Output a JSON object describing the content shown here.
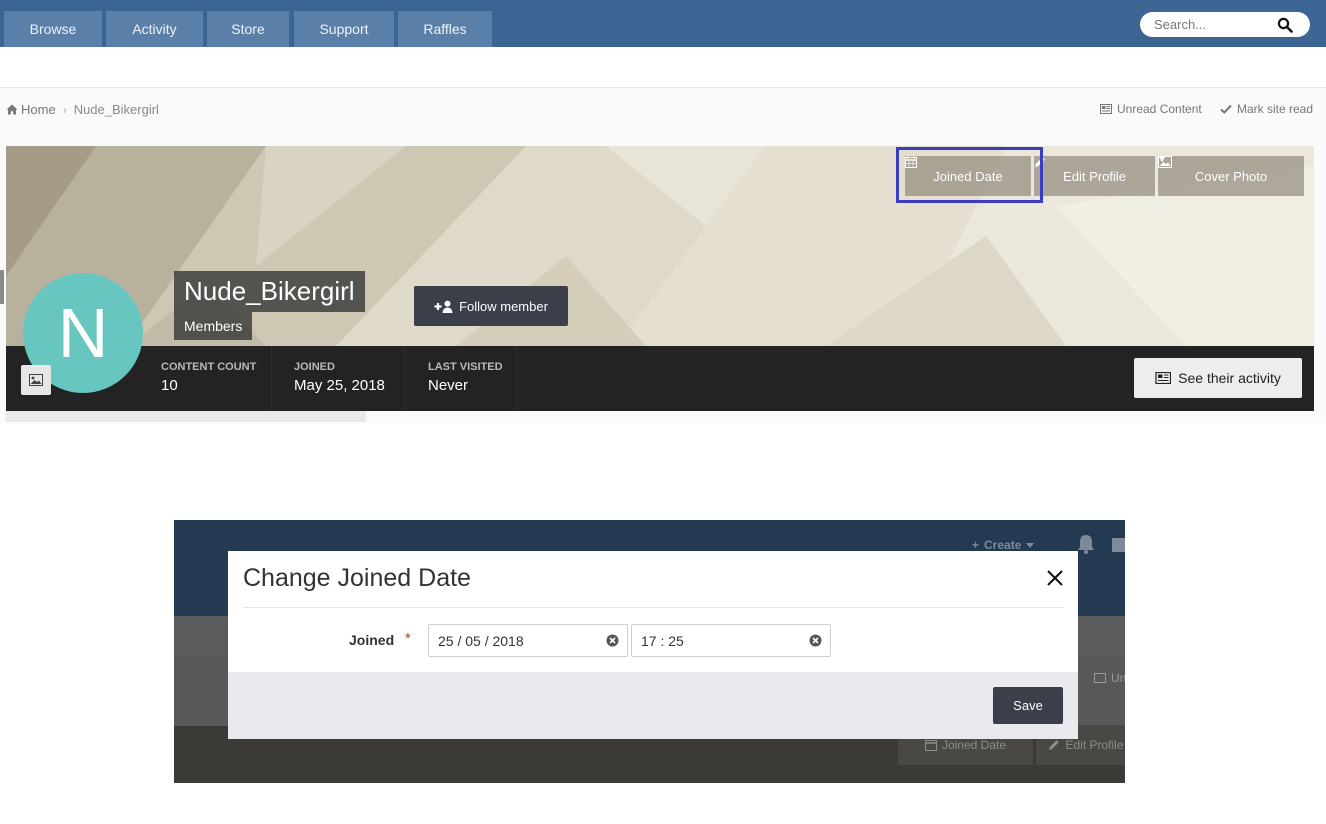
{
  "nav": {
    "tabs": [
      {
        "label": "Browse"
      },
      {
        "label": "Activity"
      },
      {
        "label": "Store"
      },
      {
        "label": "Support"
      },
      {
        "label": "Raffles"
      }
    ],
    "search_placeholder": "Search...",
    "search_icon": "search-icon",
    "colors": {
      "bar": "#3d6594",
      "tab": "#5a7fa8"
    }
  },
  "breadcrumb": {
    "home_label": "Home",
    "current": "Nude_Bikergirl",
    "home_icon": "home-icon"
  },
  "toolbar": {
    "unread_label": "Unread Content",
    "mark_read_label": "Mark site read"
  },
  "cover": {
    "joined_date_label": "Joined Date",
    "edit_profile_label": "Edit Profile",
    "cover_photo_label": "Cover Photo"
  },
  "profile": {
    "avatar_letter": "N",
    "avatar_color": "#68c6c0",
    "name": "Nude_Bikergirl",
    "group": "Members",
    "follow_label": "Follow member",
    "see_activity_label": "See their activity",
    "stats": [
      {
        "label": "Content Count",
        "value": "10"
      },
      {
        "label": "Joined",
        "value": "May 25, 2018"
      },
      {
        "label": "Last Visited",
        "value": "Never"
      }
    ]
  },
  "background_page": {
    "create_label": "Create",
    "unread_fragment": "Un",
    "joined_date_label": "Joined Date",
    "edit_profile_label": "Edit Profile"
  },
  "modal": {
    "title": "Change Joined Date",
    "field_label": "Joined",
    "required_mark": "*",
    "date_value": "25 / 05 / 2018",
    "time_value": "17 : 25",
    "save_label": "Save"
  }
}
